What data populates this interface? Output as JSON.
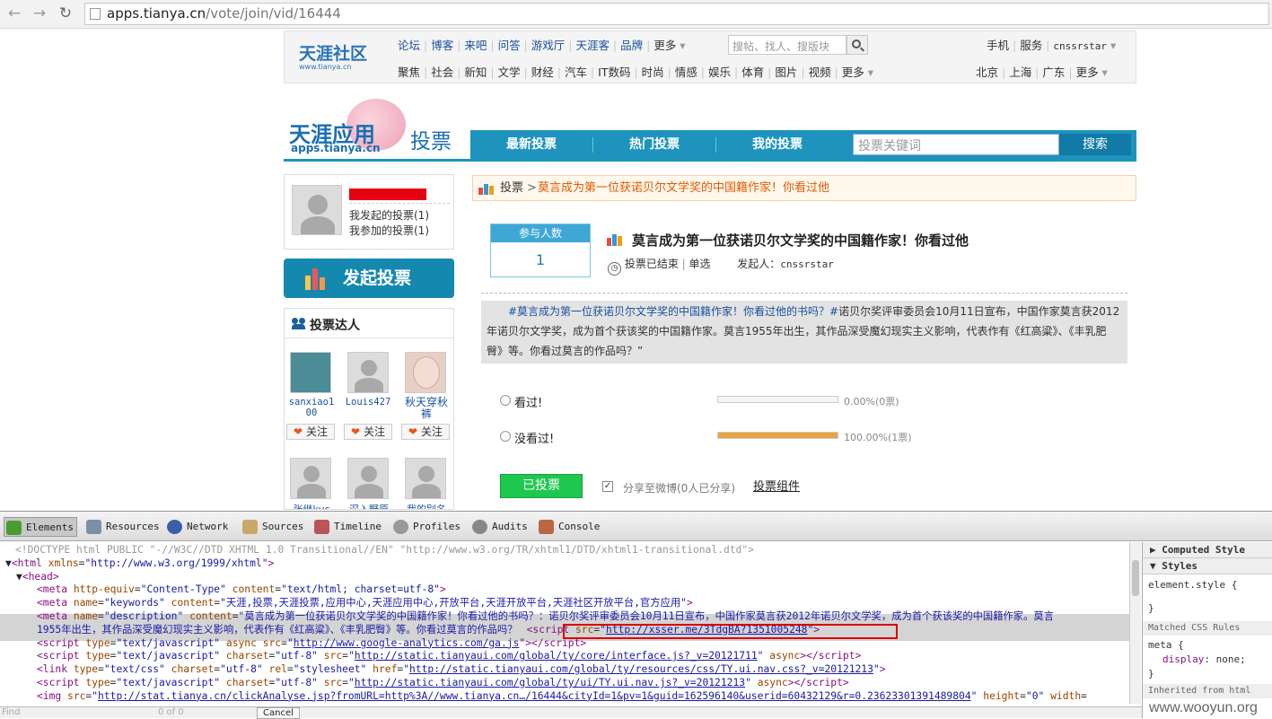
{
  "browser": {
    "url_host": "apps.tianya.cn",
    "url_path": "/vote/join/vid/16444"
  },
  "topnav": {
    "row1": [
      "论坛",
      "博客",
      "来吧",
      "问答",
      "游戏厅",
      "天涯客",
      "品牌",
      "更多"
    ],
    "search_placeholder": "搜帖、找人、搜版块",
    "right1": [
      "手机",
      "服务",
      "cnssrstar"
    ],
    "row2": [
      "聚焦",
      "社会",
      "新知",
      "文学",
      "财经",
      "汽车",
      "IT数码",
      "时尚",
      "情感",
      "娱乐",
      "体育",
      "图片",
      "视频",
      "更多"
    ],
    "right2": [
      "北京",
      "上海",
      "广东",
      "更多"
    ]
  },
  "logo": {
    "main": "天涯社区",
    "sub": "www.tianya.cn"
  },
  "applogo": {
    "main": "天涯应用",
    "sub": "apps.tianya.cn",
    "section": "投票"
  },
  "tabs": [
    "最新投票",
    "热门投票",
    "我的投票"
  ],
  "vote_search": {
    "placeholder": "投票关键词",
    "button": "搜索"
  },
  "user": {
    "my_started": "我发起的投票(1)",
    "my_joined": "我参加的投票(1)"
  },
  "start_vote": "发起投票",
  "fans": {
    "title": "投票达人",
    "users": [
      {
        "name": "sanxiao100",
        "follow": "关注"
      },
      {
        "name": "Louis427",
        "follow": "关注"
      },
      {
        "name": "秋天穿秋裤",
        "follow": "关注"
      }
    ],
    "row2_names": [
      "张继kvc",
      "深入野原",
      "我的别名"
    ]
  },
  "crumb": {
    "root": "投票",
    "current": "莫言成为第一位获诺贝尔文学奖的中国籍作家！你看过他"
  },
  "count": {
    "label": "参与人数",
    "value": "1"
  },
  "vote": {
    "title": "莫言成为第一位获诺贝尔文学奖的中国籍作家！你看过他",
    "status": "投票已结束",
    "mode": "单选",
    "initiator_label": "发起人：",
    "initiator": "cnssrstar",
    "desc_tag": "#莫言成为第一位获诺贝尔文学奖的中国籍作家！你看过他的书吗？#",
    "desc_body": "诺贝尔奖评审委员会10月11日宣布，中国作家莫言获2012年诺贝尔文学奖，成为首个获该奖的中国籍作家。莫言1955年出生，其作品深受魔幻现实主义影响，代表作有《红高粱》、《丰乳肥臀》等。你看过莫言的作品吗？”",
    "options": [
      {
        "label": "看过!",
        "percent": 0,
        "result": "0.00%(0票)"
      },
      {
        "label": "没看过!",
        "percent": 100,
        "result": "100.00%(1票)"
      }
    ],
    "voted_button": "已投票",
    "share": "分享至微博(0人已分享)",
    "widget": "投票组件"
  },
  "devtools": {
    "tabs": [
      "Elements",
      "Resources",
      "Network",
      "Sources",
      "Timeline",
      "Profiles",
      "Audits",
      "Console"
    ],
    "side_headers": [
      "Computed Style",
      "Styles"
    ],
    "side_rule": "element.style {",
    "side_close": "}",
    "matched": "Matched CSS Rules",
    "meta_rule": "meta {",
    "meta_prop": "display",
    "meta_val": "none;",
    "inherited": "Inherited from html",
    "find_placeholder": "Find",
    "find_count": "0 of 0",
    "cancel": "Cancel",
    "dom": {
      "l1": "<!DOCTYPE html PUBLIC \"-//W3C//DTD XHTML 1.0 Transitional//EN\" \"http://www.w3.org/TR/xhtml1/DTD/xhtml1-transitional.dtd\">",
      "l2a": "html",
      "l2b": "xmlns",
      "l2c": "\"http://www.w3.org/1999/xhtml\"",
      "l3": "head",
      "l4c": "\"text/html; charset=utf-8\"",
      "l5c": "\"天涯,投票,天涯投票,应用中心,天涯应用中心,开放平台,天涯开放平台,天涯社区开放平台,官方应用\"",
      "l6c": "\"莫言成为第一位获诺贝尔文学奖的中国籍作家！你看过他的书吗？：诺贝尔奖评审委员会10月11日宣布，中国作家莫言获2012年诺贝尔文学奖，成为首个获该奖的中国籍作家。莫言",
      "l6d": "1955年出生，其作品深受魔幻现实主义影响，代表作有《红高粱》、《丰乳肥臀》等。你看过莫言的作品吗？",
      "l6e": "http://xsser.me/3TdgBA?1351005248",
      "l7": "http://www.google-analytics.com/ga.js",
      "l8": "http://static.tianyaui.com/global/ty/core/interface.js?_v=20121711",
      "l9": "http://static.tianyaui.com/global/ty/resources/css/TY.ui.nav.css?_v=20121213",
      "l10": "http://static.tianyaui.com/global/ty/ui/TY.ui.nav.js?_v=20121213",
      "l11": "http://stat.tianya.cn/clickAnalyse.jsp?fromURL=http%3A//www.tianya.cn…/16444&cityId=1&pv=1&guid=162596140&userid=60432129&r=0.23623301391489804"
    }
  },
  "watermark": "www.wooyun.org"
}
